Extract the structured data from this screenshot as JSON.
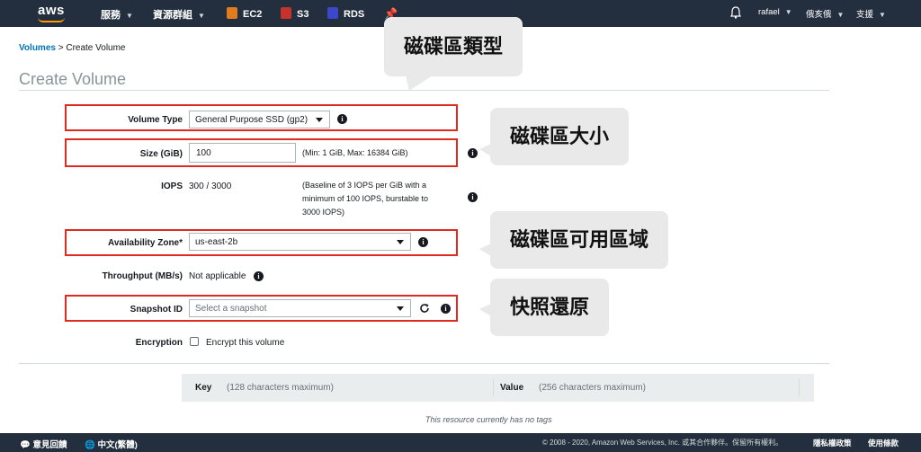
{
  "topbar": {
    "logo": "aws",
    "services": "服務",
    "resource_groups": "資源群組",
    "shortcuts": [
      {
        "label": "EC2",
        "icon": "ec2-icon",
        "color": "#e07b1f"
      },
      {
        "label": "S3",
        "icon": "s3-icon",
        "color": "#c7322b"
      },
      {
        "label": "RDS",
        "icon": "rds-icon",
        "color": "#3b48cc"
      }
    ],
    "user": "rafael",
    "region": "俄亥俄",
    "support": "支援"
  },
  "breadcrumb": {
    "link": "Volumes",
    "separator": ">",
    "current": "Create Volume"
  },
  "page_title": "Create Volume",
  "form": {
    "volume_type": {
      "label": "Volume Type",
      "value": "General Purpose SSD (gp2)"
    },
    "size": {
      "label": "Size (GiB)",
      "value": "100",
      "hint": "(Min: 1 GiB, Max: 16384 GiB)"
    },
    "iops": {
      "label": "IOPS",
      "value": "300 / 3000",
      "hint_lines": [
        "(Baseline of 3 IOPS per GiB with a",
        "minimum of 100 IOPS, burstable to",
        "3000 IOPS)"
      ]
    },
    "availability_zone": {
      "label": "Availability Zone*",
      "value": "us-east-2b"
    },
    "throughput": {
      "label": "Throughput (MB/s)",
      "value": "Not applicable"
    },
    "snapshot": {
      "label": "Snapshot ID",
      "placeholder": "Select a snapshot"
    },
    "encryption": {
      "label": "Encryption",
      "checkbox_label": "Encrypt this volume",
      "checked": false
    }
  },
  "tags": {
    "key_label": "Key",
    "key_hint": "(128 characters maximum)",
    "value_label": "Value",
    "value_hint": "(256 characters maximum)",
    "empty_text": "This resource currently has no tags"
  },
  "annotations": {
    "volume_type": "磁碟區類型",
    "size": "磁碟區大小",
    "availability_zone": "磁碟區可用區域",
    "snapshot": "快照還原"
  },
  "footer": {
    "feedback": "意見回饋",
    "language": "中文(繁體)",
    "copyright": "© 2008 - 2020, Amazon Web Services, Inc. 或其合作夥伴。保留所有權利。",
    "privacy": "隱私權政策",
    "terms": "使用條款"
  },
  "colors": {
    "topbar": "#232f3e",
    "link": "#0073bb",
    "highlight": "#e0291f",
    "accent": "#ff9900"
  }
}
